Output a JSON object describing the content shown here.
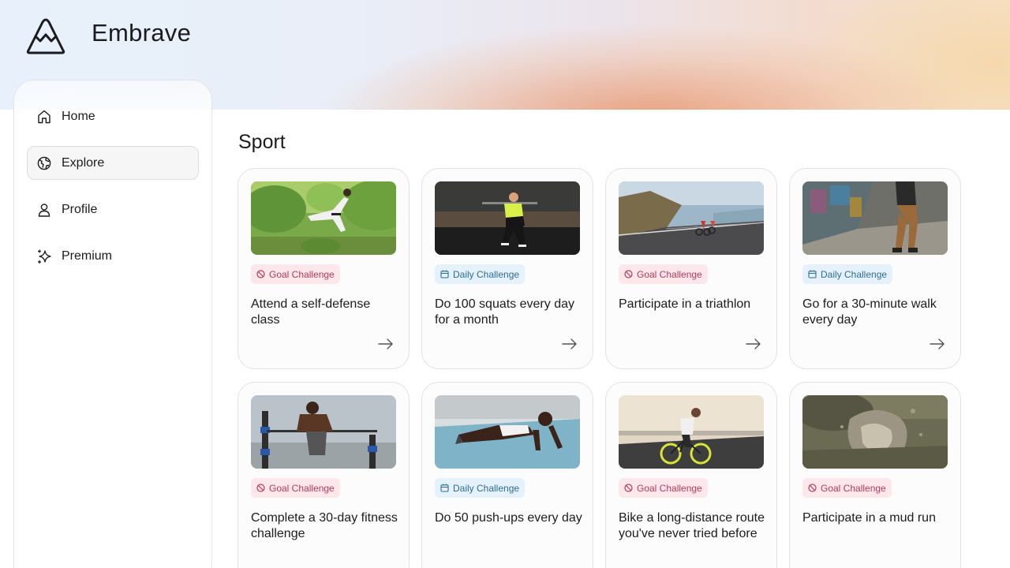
{
  "app": {
    "brand": "Embrave"
  },
  "sidebar": {
    "items": [
      {
        "label": "Home",
        "icon": "home-icon",
        "active": false
      },
      {
        "label": "Explore",
        "icon": "globe-icon",
        "active": true
      },
      {
        "label": "Profile",
        "icon": "user-icon",
        "active": false
      },
      {
        "label": "Premium",
        "icon": "sparkles-icon",
        "active": false
      }
    ]
  },
  "main": {
    "section_title": "Sport",
    "cards": [
      {
        "image": "martial-arts-kick-photo",
        "badge": "Goal Challenge",
        "badge_type": "goal",
        "title": "Attend a self-defense class",
        "has_arrow": true
      },
      {
        "image": "squat-workout-photo",
        "badge": "Daily Challenge",
        "badge_type": "daily",
        "title": "Do 100 squats every day for a month",
        "has_arrow": true
      },
      {
        "image": "cyclists-coastal-road-photo",
        "badge": "Goal Challenge",
        "badge_type": "goal",
        "title": "Participate in a triathlon",
        "has_arrow": true
      },
      {
        "image": "walking-street-photo",
        "badge": "Daily Challenge",
        "badge_type": "daily",
        "title": "Go for a 30-minute walk every day",
        "has_arrow": true
      },
      {
        "image": "parallel-bars-dip-photo",
        "badge": "Goal Challenge",
        "badge_type": "goal",
        "title": "Complete a 30-day fitness challenge",
        "has_arrow": false
      },
      {
        "image": "push-up-photo",
        "badge": "Daily Challenge",
        "badge_type": "daily",
        "title": "Do 50 push-ups every day",
        "has_arrow": false
      },
      {
        "image": "road-bike-sunset-photo",
        "badge": "Goal Challenge",
        "badge_type": "goal",
        "title": "Bike a long-distance route you've never tried before",
        "has_arrow": false
      },
      {
        "image": "mud-run-splash-photo",
        "badge": "Goal Challenge",
        "badge_type": "goal",
        "title": "Participate in a mud run",
        "has_arrow": false
      }
    ]
  },
  "colors": {
    "goal_badge_bg": "#fce8ec",
    "goal_badge_text": "#b43a5e",
    "daily_badge_bg": "#e5f1fb",
    "daily_badge_text": "#2f6e96"
  }
}
